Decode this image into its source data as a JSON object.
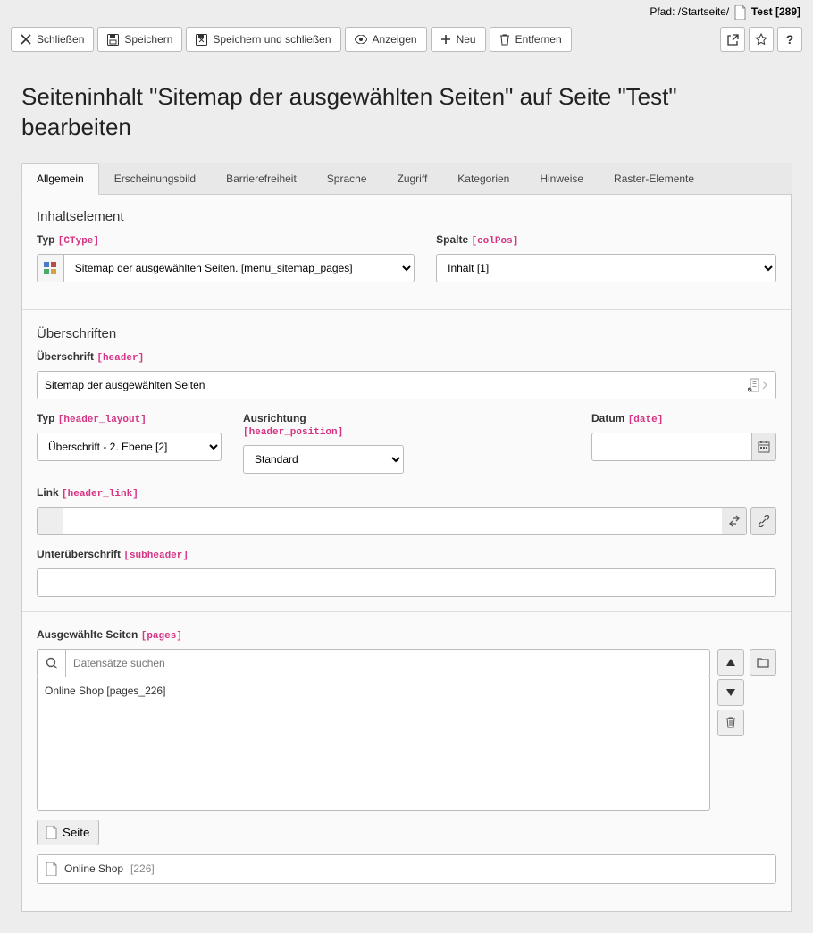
{
  "path": {
    "label": "Pfad:",
    "root": "/Startseite/",
    "page": "Test",
    "uid": "[289]"
  },
  "toolbar": {
    "close": "Schließen",
    "save": "Speichern",
    "save_close": "Speichern und schließen",
    "view": "Anzeigen",
    "new": "Neu",
    "delete": "Entfernen"
  },
  "title": "Seiteninhalt \"Sitemap der ausgewählten Seiten\" auf Seite \"Test\" bearbeiten",
  "tabs": [
    "Allgemein",
    "Erscheinungsbild",
    "Barrierefreiheit",
    "Sprache",
    "Zugriff",
    "Kategorien",
    "Hinweise",
    "Raster-Elemente"
  ],
  "sections": {
    "element": "Inhaltselement",
    "headlines": "Überschriften"
  },
  "fields": {
    "type": {
      "label": "Typ",
      "code": "[CType]",
      "value": "Sitemap der ausgewählten Seiten. [menu_sitemap_pages]"
    },
    "column": {
      "label": "Spalte",
      "code": "[colPos]",
      "value": "Inhalt [1]"
    },
    "header": {
      "label": "Überschrift",
      "code": "[header]",
      "value": "Sitemap der ausgewählten Seiten"
    },
    "header_layout": {
      "label": "Typ",
      "code": "[header_layout]",
      "value": "Überschrift - 2. Ebene [2]"
    },
    "header_position": {
      "label": "Ausrichtung",
      "code": "[header_position]",
      "value": "Standard"
    },
    "date": {
      "label": "Datum",
      "code": "[date]",
      "value": ""
    },
    "header_link": {
      "label": "Link",
      "code": "[header_link]",
      "value": ""
    },
    "subheader": {
      "label": "Unterüberschrift",
      "code": "[subheader]",
      "value": ""
    },
    "pages": {
      "label": "Ausgewählte Seiten",
      "code": "[pages]",
      "search_placeholder": "Datensätze suchen",
      "items": [
        "Online Shop [pages_226]"
      ],
      "add_btn": "Seite",
      "result": {
        "title": "Online Shop",
        "uid": "[226]"
      }
    }
  }
}
